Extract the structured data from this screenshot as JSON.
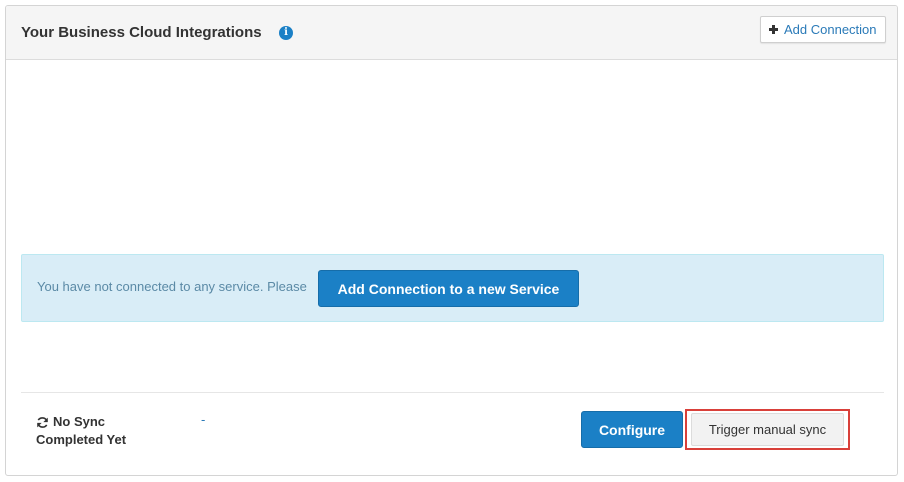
{
  "header": {
    "title": "Your Business Cloud Integrations",
    "info_icon": "info-icon",
    "add_connection_label": "Add Connection"
  },
  "alert": {
    "message": "You have not connected to any service. Please",
    "button_label": "Add Connection to a new Service"
  },
  "footer": {
    "sync_status_line1": "No Sync",
    "sync_status_line2": "Completed Yet",
    "sync_value": "-",
    "configure_label": "Configure",
    "manual_sync_label": "Trigger manual sync"
  },
  "colors": {
    "primary": "#1b80c6",
    "alert_bg": "#d9edf7",
    "highlight_border": "#d9403a"
  }
}
